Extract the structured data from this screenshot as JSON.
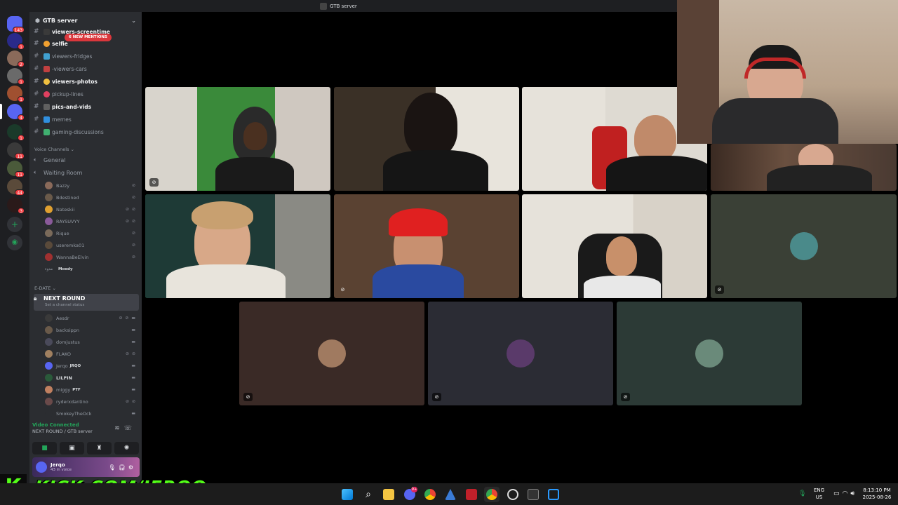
{
  "window": {
    "title": "GTB server"
  },
  "rail": {
    "home_badge": "143",
    "server_badges": [
      "1",
      "2",
      "1",
      "1",
      "4",
      "1",
      "11",
      "44",
      "3"
    ]
  },
  "sidebar": {
    "server_name": "GTB server",
    "new_mentions": "6 NEW MENTIONS",
    "channels": [
      {
        "label": "viewers-screentime",
        "unread": true
      },
      {
        "label": "selfie",
        "unread": true
      },
      {
        "label": "viewers-fridges",
        "unread": false
      },
      {
        "label": "-viewers-cars",
        "unread": false
      },
      {
        "label": "viewers-photos",
        "unread": true
      },
      {
        "label": "pickup-lines",
        "unread": false
      },
      {
        "label": "pics-and-vids",
        "unread": true
      },
      {
        "label": "memes",
        "unread": false
      },
      {
        "label": "gaming-discussions",
        "unread": false
      }
    ],
    "voice_category": "Voice Channels",
    "voice_channels": [
      "General",
      "Waiting Room"
    ],
    "waiting_users": [
      "Bazzy",
      "Bdestined",
      "Nateskii",
      "RAYSUVYY",
      "Rique",
      "useremka01",
      "WannaBeElvin",
      "Moody"
    ],
    "waiting_user_prefix": "مدوء",
    "edate_category": "E-DATE",
    "active_channel": {
      "name": "NEXT ROUND",
      "status": "Set a channel status"
    },
    "round_users": [
      {
        "name": "Aesdr",
        "tag": ""
      },
      {
        "name": "backsippn",
        "tag": ""
      },
      {
        "name": "domjustus",
        "tag": ""
      },
      {
        "name": "FLAKO",
        "tag": ""
      },
      {
        "name": "Jerqo",
        "tag": "JRQO"
      },
      {
        "name": "LILFIN",
        "tag": ""
      },
      {
        "name": "miggy",
        "tag": "PTF"
      },
      {
        "name": "ryderxdantino",
        "tag": ""
      },
      {
        "name": "SmokeyTheOck",
        "tag": ""
      }
    ]
  },
  "voice_panel": {
    "status": "Video Connected",
    "channel": "NEXT ROUND / GTB server"
  },
  "user": {
    "name": "Jerqo",
    "status": "43 in voice"
  },
  "watermark": {
    "letter": "K",
    "text": "KICK.COM/JERQO",
    "color": "#53fc18"
  },
  "taskbar": {
    "lang_top": "ENG",
    "lang_bottom": "US",
    "time": "8:13:10 PM",
    "date": "2025-08-26",
    "discord_badge": "9+"
  },
  "colors": {
    "speaking": "#23a55a",
    "mention": "#da373c",
    "sidebar": "#2b2d31"
  }
}
